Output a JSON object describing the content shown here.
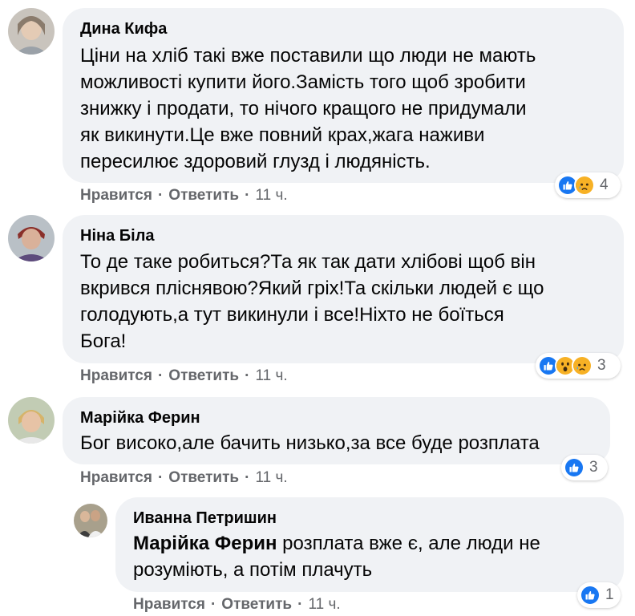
{
  "comments": [
    {
      "author": "Дина Кифа",
      "lines": [
        "Ціни на хліб такі вже поставили що люди не мають",
        "можливості купити його.Замість того щоб зробити",
        "знижку і продати, то нічого кращого не придумали",
        "як викинути.Це вже повний крах,жага наживи",
        "пересилює здоровий глузд і людяність."
      ],
      "like_label": "Нравится",
      "reply_label": "Ответить",
      "time": "11 ч.",
      "reaction_icons": [
        "like-reaction-icon",
        "sad-reaction-icon"
      ],
      "reaction_count": "4"
    },
    {
      "author": "Ніна Біла",
      "lines": [
        "То де таке робиться?Та як так дати хлібові щоб він",
        "вкрився пліснявою?Який гріх!Та скільки людей є що",
        "голодують,а тут викинули і все!Ніхто не боїться",
        "Бога!"
      ],
      "like_label": "Нравится",
      "reply_label": "Ответить",
      "time": "11 ч.",
      "reaction_icons": [
        "like-reaction-icon",
        "wow-reaction-icon",
        "sad-reaction-icon"
      ],
      "reaction_count": "3"
    },
    {
      "author": "Марійка Ферин",
      "lines": [
        "Бог високо,але бачить низько,за все буде розплата"
      ],
      "like_label": "Нравится",
      "reply_label": "Ответить",
      "time": "11 ч.",
      "reaction_icons": [
        "like-reaction-icon"
      ],
      "reaction_count": "3"
    }
  ],
  "reply": {
    "author": "Иванна Петришин",
    "mention": "Марійка Ферин",
    "line1_rest": " розплата вже є, але люди не",
    "line2": "розуміють, а потім плачуть",
    "like_label": "Нравится",
    "reply_label": "Ответить",
    "time": "11 ч.",
    "reaction_icons": [
      "like-reaction-icon"
    ],
    "reaction_count": "1"
  },
  "separator": "·",
  "colors": {
    "bubble": "#f0f2f5",
    "meta_text": "#65676b",
    "like_blue": "#1877f2",
    "reaction_yellow": "#f7b125"
  }
}
